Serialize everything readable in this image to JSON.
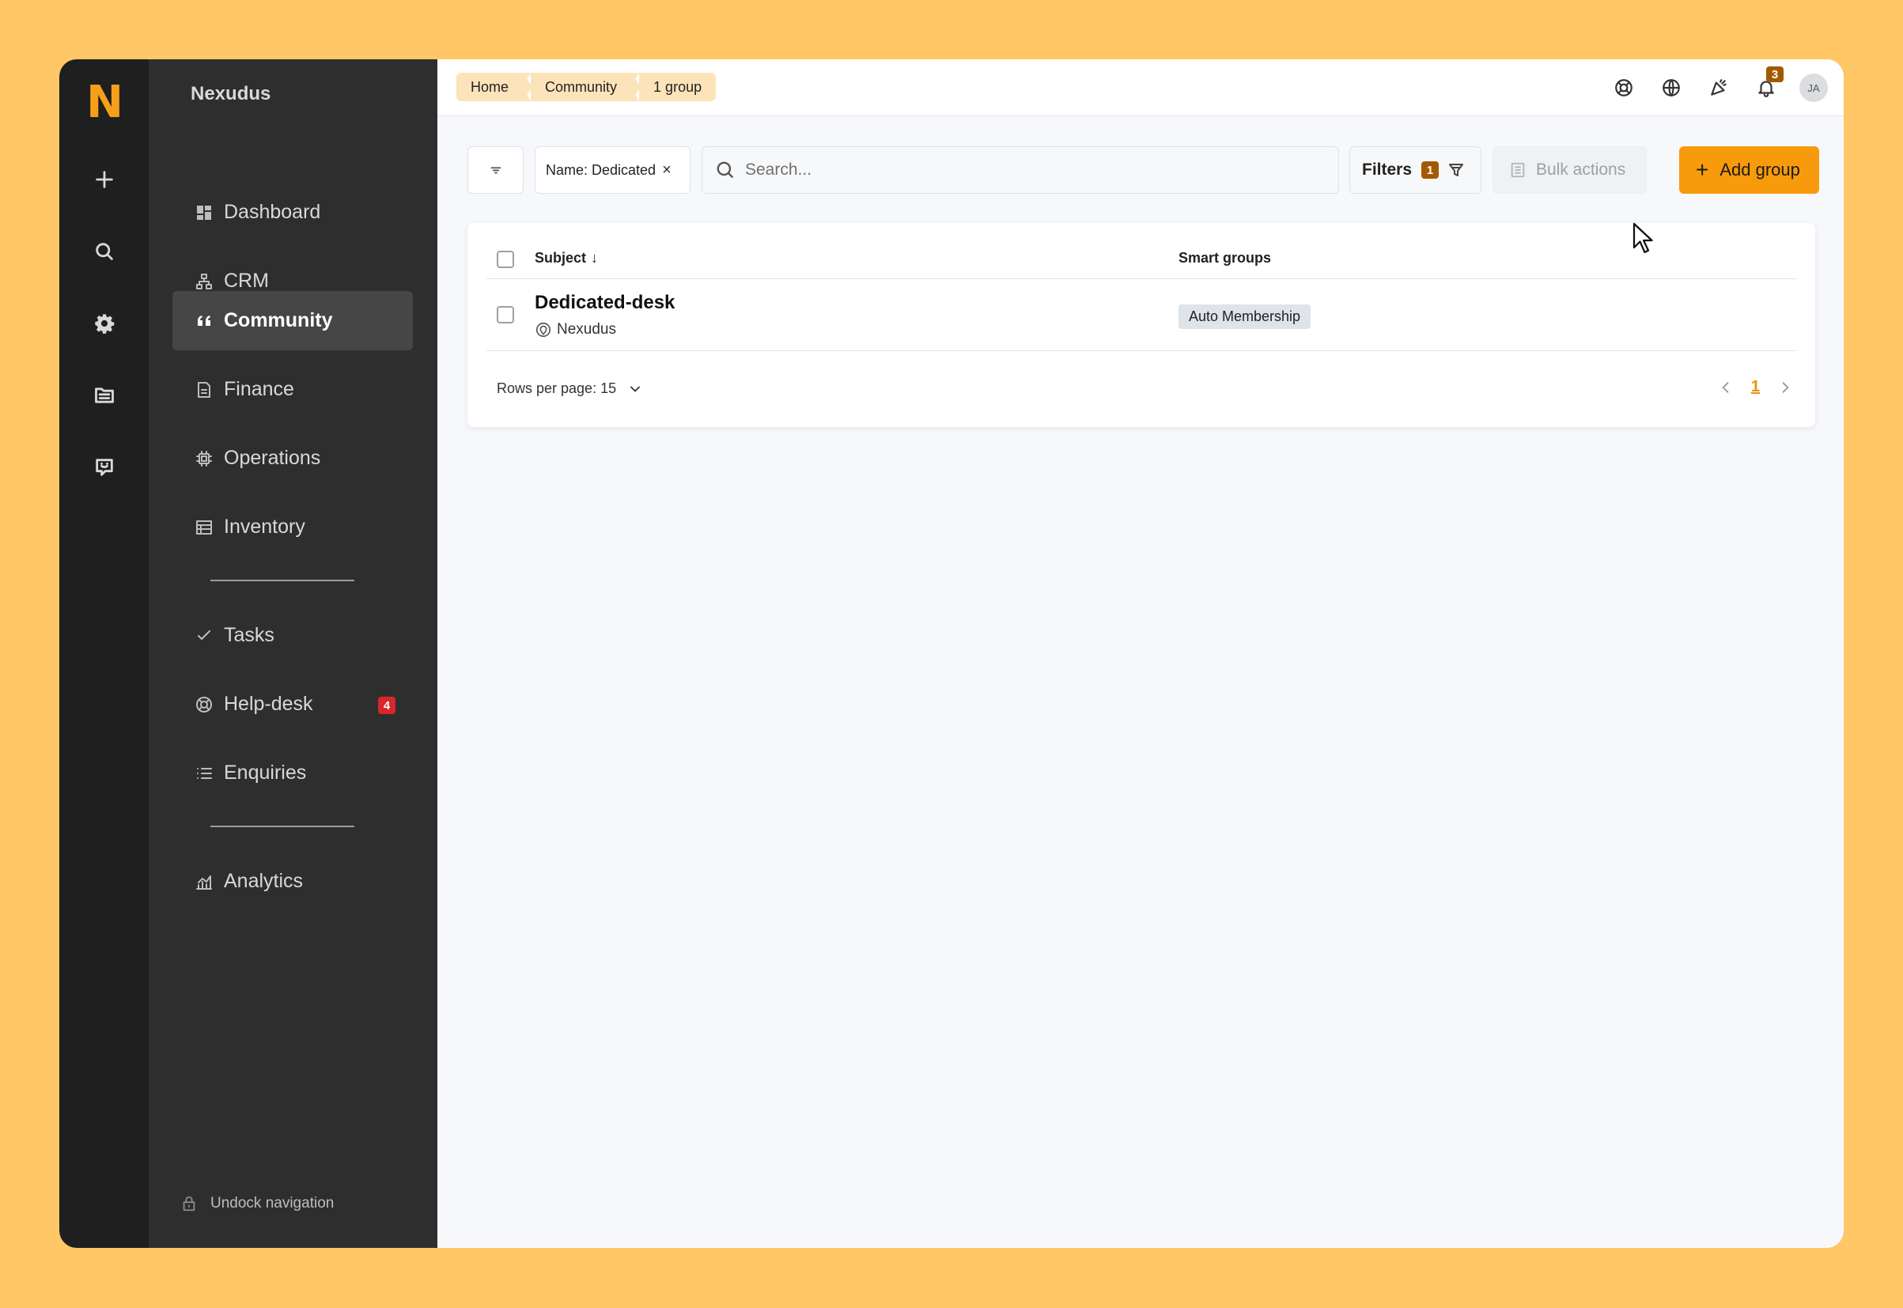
{
  "brand": {
    "logo": "N",
    "name": "Nexudus"
  },
  "rail": {
    "buttons": [
      "plus-icon",
      "search-icon",
      "gear-icon",
      "folder-icon",
      "chat-support-icon"
    ]
  },
  "nav": {
    "items": [
      {
        "label": "Dashboard",
        "icon": "dashboard-icon"
      },
      {
        "label": "CRM",
        "icon": "crm-icon"
      },
      {
        "label": "Community",
        "icon": "quote-icon",
        "active": true
      },
      {
        "label": "Finance",
        "icon": "document-icon"
      },
      {
        "label": "Operations",
        "icon": "chip-icon"
      },
      {
        "label": "Inventory",
        "icon": "table-icon"
      },
      {
        "label": "Tasks",
        "icon": "check-icon"
      },
      {
        "label": "Help-desk",
        "icon": "lifebuoy-icon",
        "badge": "4"
      },
      {
        "label": "Enquiries",
        "icon": "list-icon"
      },
      {
        "label": "Analytics",
        "icon": "chart-icon"
      }
    ],
    "undock": "Undock navigation"
  },
  "breadcrumb": [
    "Home",
    "Community",
    "1 group"
  ],
  "topbar": {
    "notifications": "3",
    "avatar": "JA"
  },
  "toolbar": {
    "filter_chip": "Name: Dedicated",
    "search_placeholder": "Search...",
    "filters_label": "Filters",
    "filters_count": "1",
    "bulk_label": "Bulk actions",
    "add_label": "Add group"
  },
  "table": {
    "columns": [
      "Subject",
      "Smart groups"
    ],
    "rows": [
      {
        "name": "Dedicated-desk",
        "location": "Nexudus",
        "smart_group": "Auto Membership"
      }
    ],
    "rows_per_page": "Rows per page: 15",
    "page": "1"
  },
  "colors": {
    "accent": "#f79a0b",
    "rail": "#1f1f1f",
    "nav": "#2e2e2e",
    "background": "#FFC766"
  }
}
